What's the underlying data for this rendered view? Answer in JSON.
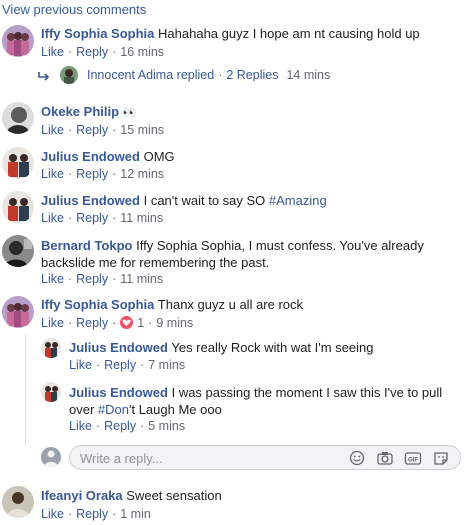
{
  "view_previous": "View previous comments",
  "actions": {
    "like": "Like",
    "reply": "Reply",
    "sep": "·"
  },
  "comments": [
    {
      "author": "Iffy Sophia Sophia",
      "text": "Hahahaha guyz I hope am nt causing hold up",
      "time": "16 mins"
    },
    {
      "author": "Okeke Philip",
      "text": "👀",
      "time": "15 mins"
    },
    {
      "author": "Julius Endowed",
      "text": "OMG",
      "time": "12 mins"
    },
    {
      "author": "Julius Endowed",
      "text": "I can't wait to say SO ",
      "hashtag": "#Amazing",
      "time": "11 mins"
    },
    {
      "author": "Bernard Tokpo",
      "text_line1": "Iffy Sophia Sophia, I must confess. You've already",
      "text_line2": "backslide me for remembering the past.",
      "time": "11 mins"
    },
    {
      "author": "Iffy Sophia Sophia",
      "text": "Thanx guyz u all are rock",
      "reaction_count": "1",
      "time": "9 mins"
    },
    {
      "author": "Ifeanyi Oraka",
      "text": "Sweet sensation",
      "time": "1 min"
    }
  ],
  "replies_summary": {
    "author": "Innocent Adima",
    "replied": "replied",
    "count": "2 Replies",
    "time": "14 mins"
  },
  "replies": [
    {
      "author": "Julius Endowed",
      "text": "Yes really Rock with wat I'm seeing",
      "time": "7 mins"
    },
    {
      "author": "Julius Endowed",
      "text_before": "I was passing the moment I saw this I've to pull",
      "text_line2_before": "over ",
      "hashtag": "#Don",
      "text_after": "'t Laugh Me ooo",
      "time": "5 mins"
    }
  ],
  "reply_box": {
    "placeholder": "Write a reply...",
    "icons": [
      "smiley-icon",
      "camera-icon",
      "gif-icon",
      "sticker-icon"
    ]
  },
  "colors": {
    "link": "#385898",
    "meta": "#606770",
    "reaction": "#f25268"
  }
}
